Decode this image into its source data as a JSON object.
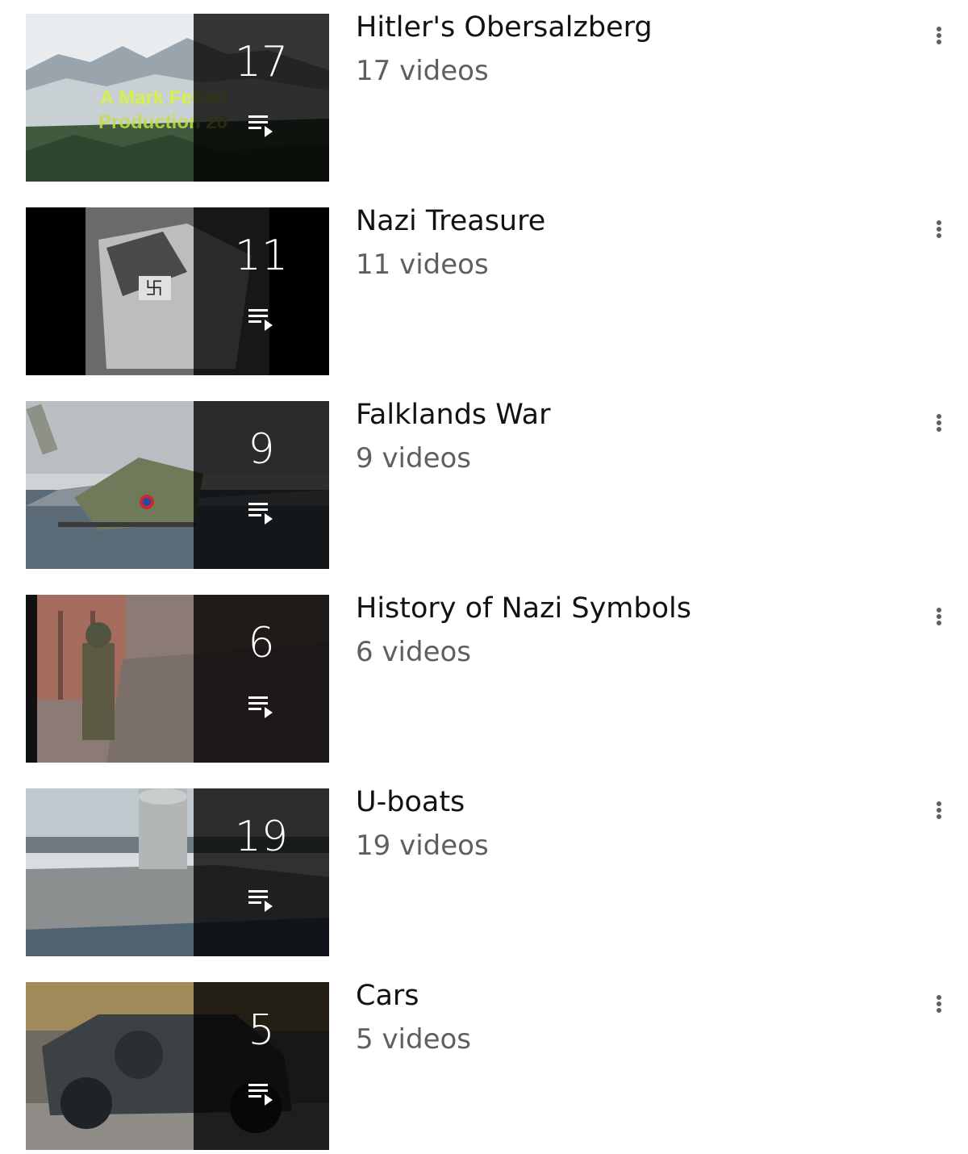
{
  "playlists": [
    {
      "title": "Hitler's Obersalzberg",
      "count": "17",
      "subtitle": "17 videos",
      "thumbnail": "snowy-mountain",
      "thumb_text": [
        "A Mark Felton",
        "Production 20"
      ]
    },
    {
      "title": "Nazi Treasure",
      "count": "11",
      "subtitle": "11 videos",
      "thumbnail": "treasure-crate"
    },
    {
      "title": "Falklands War",
      "count": "9",
      "subtitle": "9 videos",
      "thumbnail": "helicopter"
    },
    {
      "title": "History of Nazi Symbols",
      "count": "6",
      "subtitle": "6 videos",
      "thumbnail": "soldier-tank"
    },
    {
      "title": "U-boats",
      "count": "19",
      "subtitle": "19 videos",
      "thumbnail": "submarine"
    },
    {
      "title": "Cars",
      "count": "5",
      "subtitle": "5 videos",
      "thumbnail": "military-car"
    }
  ],
  "colors": {
    "title": "#111111",
    "subtitle": "#5f5f5f",
    "overlay": "rgba(0,0,0,0.78)",
    "menu_dots": "#606060"
  },
  "icons": {
    "playlist": "playlist-play-icon",
    "menu": "more-vert-icon"
  }
}
